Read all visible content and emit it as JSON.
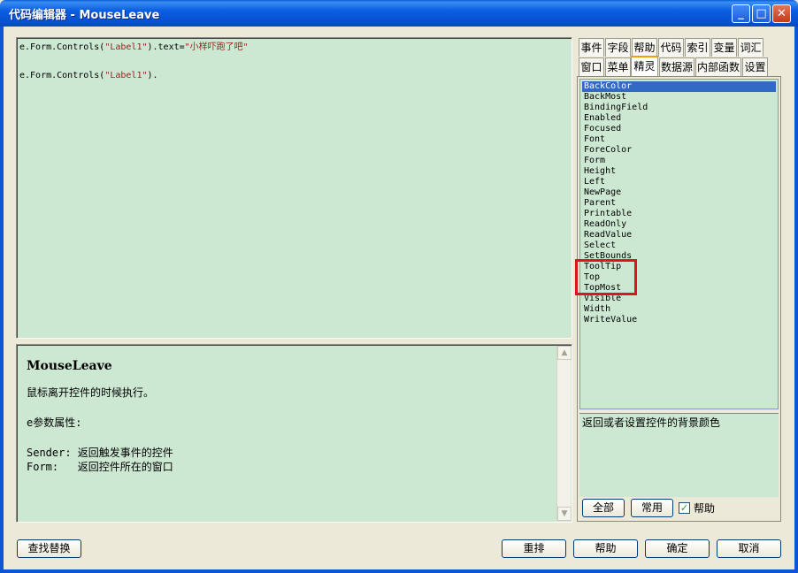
{
  "window": {
    "title": "代码编辑器 - MouseLeave",
    "minimize": "_",
    "maximize": "□",
    "close": "✕"
  },
  "editor": {
    "lines": [
      {
        "prefix": "e.Form.Controls(",
        "str1": "\"Label1\"",
        "mid": ").text=",
        "str2": "\"小样吓跑了吧\"",
        "suffix": ""
      },
      {
        "prefix": "",
        "str1": "",
        "mid": "",
        "str2": "",
        "suffix": ""
      },
      {
        "prefix": "e.Form.Controls(",
        "str1": "\"Label1\"",
        "mid": ").",
        "str2": "",
        "suffix": ""
      }
    ]
  },
  "help": {
    "title": "MouseLeave",
    "description": "鼠标离开控件的时候执行。",
    "params_heading": "e参数属性:",
    "params": [
      "Sender: 返回触发事件的控件",
      "Form:   返回控件所在的窗口"
    ]
  },
  "tabs": {
    "row1": [
      "事件",
      "字段",
      "帮助",
      "代码",
      "索引",
      "变量",
      "词汇"
    ],
    "row2": [
      "窗口",
      "菜单",
      "精灵",
      "数据源",
      "内部函数",
      "设置"
    ],
    "active": "精灵"
  },
  "property_list": {
    "items": [
      "BackColor",
      "BackMost",
      "BindingField",
      "Enabled",
      "Focused",
      "Font",
      "ForeColor",
      "Form",
      "Height",
      "Left",
      "NewPage",
      "Parent",
      "Printable",
      "ReadOnly",
      "ReadValue",
      "Select",
      "SetBounds",
      "ToolTip",
      "Top",
      "TopMost",
      "Visible",
      "Width",
      "WriteValue"
    ],
    "selected": "BackColor"
  },
  "description_text": "返回或者设置控件的背景颜色",
  "filter": {
    "all_label": "全部",
    "common_label": "常用",
    "help_checkbox_label": "帮助",
    "help_checked": true
  },
  "bottom_buttons": {
    "find_replace": "查找替换",
    "rearrange": "重排",
    "help": "帮助",
    "ok": "确定",
    "cancel": "取消"
  },
  "colors": {
    "editor_bg": "#cde8d2",
    "highlight_border": "#e0141e",
    "selection": "#316ac5"
  }
}
